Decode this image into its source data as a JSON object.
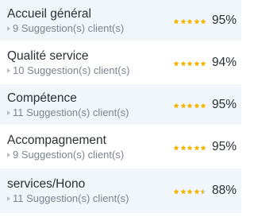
{
  "colors": {
    "star_filled": "#f5b400",
    "star_empty": "#cfd4da",
    "row_alt_bg": "#f1f6fb",
    "title_text": "#2a2f36",
    "sub_text": "#7a8592"
  },
  "criteria": [
    {
      "title": "Accueil général",
      "suggestions": "9 Suggestion(s) client(s)",
      "rating": 5,
      "percent": "95%"
    },
    {
      "title": "Qualité service",
      "suggestions": "10 Suggestion(s) client(s)",
      "rating": 5,
      "percent": "94%"
    },
    {
      "title": "Compétence",
      "suggestions": "11 Suggestion(s) client(s)",
      "rating": 5,
      "percent": "95%"
    },
    {
      "title": "Accompagnement",
      "suggestions": "9 Suggestion(s) client(s)",
      "rating": 5,
      "percent": "95%"
    },
    {
      "title": "services/Hono",
      "suggestions": "11 Suggestion(s) client(s)",
      "rating": 4.5,
      "percent": "88%"
    }
  ]
}
